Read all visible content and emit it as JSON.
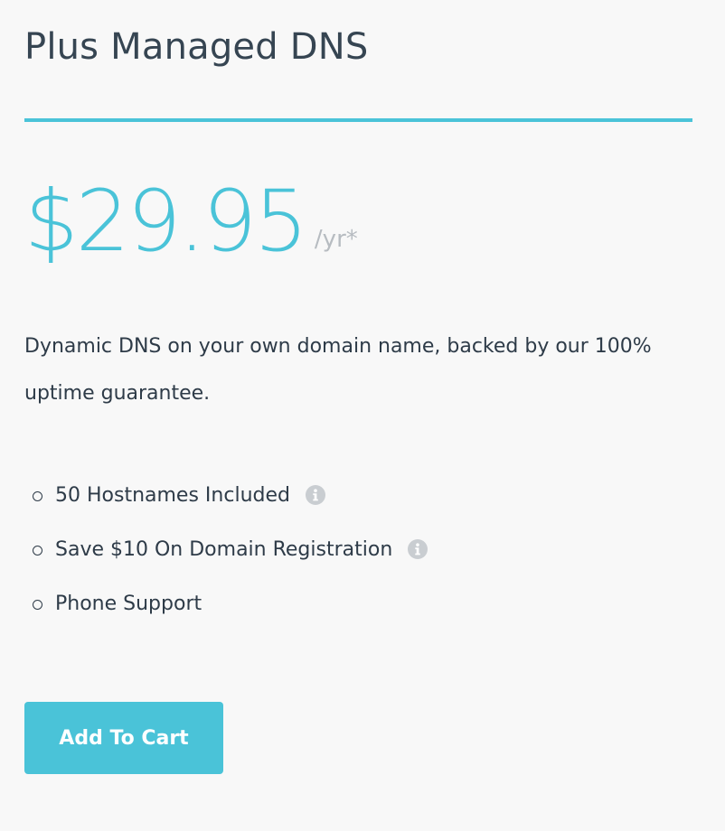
{
  "plan": {
    "title": "Plus Managed DNS",
    "price": "$29.95",
    "price_suffix": "/yr*",
    "description": "Dynamic DNS on your own domain name, backed by our 100% uptime guarantee.",
    "features": [
      {
        "label": "50 Hostnames Included",
        "icon": "info-icon"
      },
      {
        "label": "Save $10 On Domain Registration",
        "icon": "info-icon"
      },
      {
        "label": "Phone Support"
      }
    ],
    "cta_label": "Add To Cart"
  },
  "colors": {
    "accent": "#4ac3d8",
    "text": "#2e3b48",
    "muted": "#b7bcc1",
    "icon": "#c9cdd1",
    "background": "#f8f8f8"
  }
}
